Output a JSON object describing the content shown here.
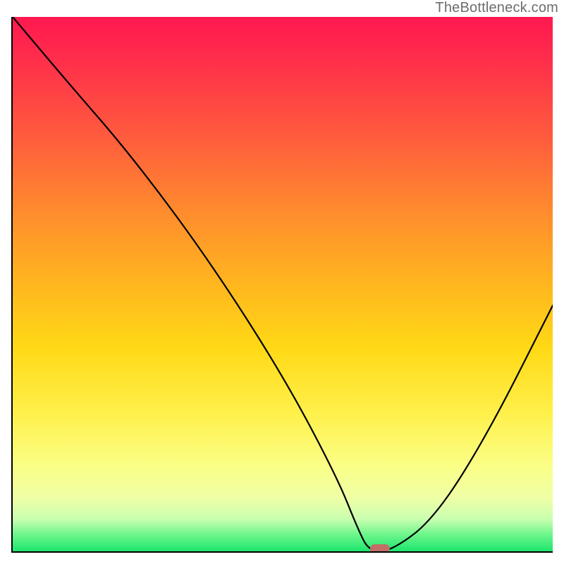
{
  "attribution": "TheBottleneck.com",
  "chart_data": {
    "type": "line",
    "title": "",
    "xlabel": "",
    "ylabel": "",
    "xlim": [
      0,
      100
    ],
    "ylim": [
      0,
      100
    ],
    "grid": false,
    "series": [
      {
        "name": "curve",
        "x": [
          0,
          10,
          22,
          36,
          50,
          60,
          64,
          66,
          70,
          78,
          88,
          100
        ],
        "y": [
          100,
          88,
          74,
          55,
          33,
          14,
          4,
          0,
          0,
          6,
          22,
          46
        ]
      }
    ],
    "marker": {
      "x": 68,
      "y": 0,
      "color": "#c26e66",
      "shape": "pill"
    },
    "background_gradient_stops": [
      {
        "pos": 0,
        "color": "#ff1850"
      },
      {
        "pos": 50,
        "color": "#ffb61f"
      },
      {
        "pos": 84,
        "color": "#fbff86"
      },
      {
        "pos": 100,
        "color": "#1de56f"
      }
    ]
  }
}
